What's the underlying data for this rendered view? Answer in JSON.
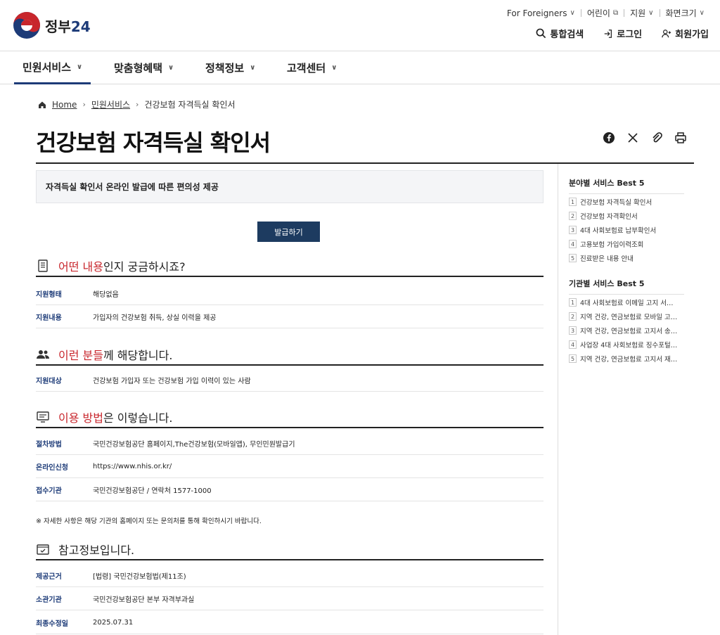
{
  "header": {
    "logo_text": "정부",
    "logo_num": "24",
    "util": [
      "For Foreigners",
      "어린이",
      "지원",
      "화면크기"
    ],
    "actions": [
      "통합검색",
      "로그인",
      "회원가입"
    ]
  },
  "gnb": [
    "민원서비스",
    "맞춤형혜택",
    "정책정보",
    "고객센터"
  ],
  "breadcrumb": [
    "Home",
    "민원서비스",
    "건강보험 자격득실 확인서"
  ],
  "title": "건강보험 자격득실 확인서",
  "summary": "자격득실 확인서 온라인 발급에 따른 편의성 제공",
  "issue_button": "발급하기",
  "sections": {
    "what": {
      "hl": "어떤 내용",
      "rest": "인지 궁금하시죠?",
      "rows": [
        {
          "k": "지원형태",
          "v": "해당없음"
        },
        {
          "k": "지원내용",
          "v": "가입자의 건강보험 취득, 상실 이력을 제공"
        }
      ]
    },
    "who": {
      "hl": "이런 분들",
      "rest": "께 해당합니다.",
      "rows": [
        {
          "k": "지원대상",
          "v": "건강보험 가입자 또는 건강보험 가입 이력이 있는 사람"
        }
      ]
    },
    "how": {
      "hl": "이용 방법",
      "rest": "은 이렇습니다.",
      "rows": [
        {
          "k": "절차방법",
          "v": "국민건강보험공단 홈페이지,The건강보험(모바일앱), 무인민원발급기"
        },
        {
          "k": "온라인신청",
          "v": "https://www.nhis.or.kr/"
        },
        {
          "k": "접수기관",
          "v": "국민건강보험공단 / 연락처 1577-1000"
        }
      ],
      "note": "※ 자세한 사항은 해당 기관의 홈페이지 또는 문의처를 통해 확인하시기 바랍니다."
    },
    "ref": {
      "title": "참고정보입니다.",
      "rows": [
        {
          "k": "제공근거",
          "v": "[법령] 국민건강보험법(제11조)"
        },
        {
          "k": "소관기관",
          "v": "국민건강보험공단 본부 자격부과실"
        },
        {
          "k": "최종수정일",
          "v": "2025.07.31"
        }
      ]
    }
  },
  "sidebar": {
    "field_title": "분야별 서비스 Best 5",
    "field_items": [
      "건강보험 자격득실 확인서",
      "건강보험 자격확인서",
      "4대 사회보험료 납부확인서",
      "고용보험 가입이력조회",
      "진료받은 내용 안내"
    ],
    "org_title": "기관별 서비스 Best 5",
    "org_items": [
      "4대 사회보험료 이메일 고지 서…",
      "지역 건강, 연금보험료 모바일 고…",
      "지역 건강, 연금보험료 고지서 송…",
      "사업장 4대 사회보험료 징수포털…",
      "지역 건강, 연금보험료 고지서 재…"
    ]
  },
  "colors": {
    "accent": "#1d3b78",
    "highlight": "#c8262c",
    "button": "#1d3b60"
  }
}
